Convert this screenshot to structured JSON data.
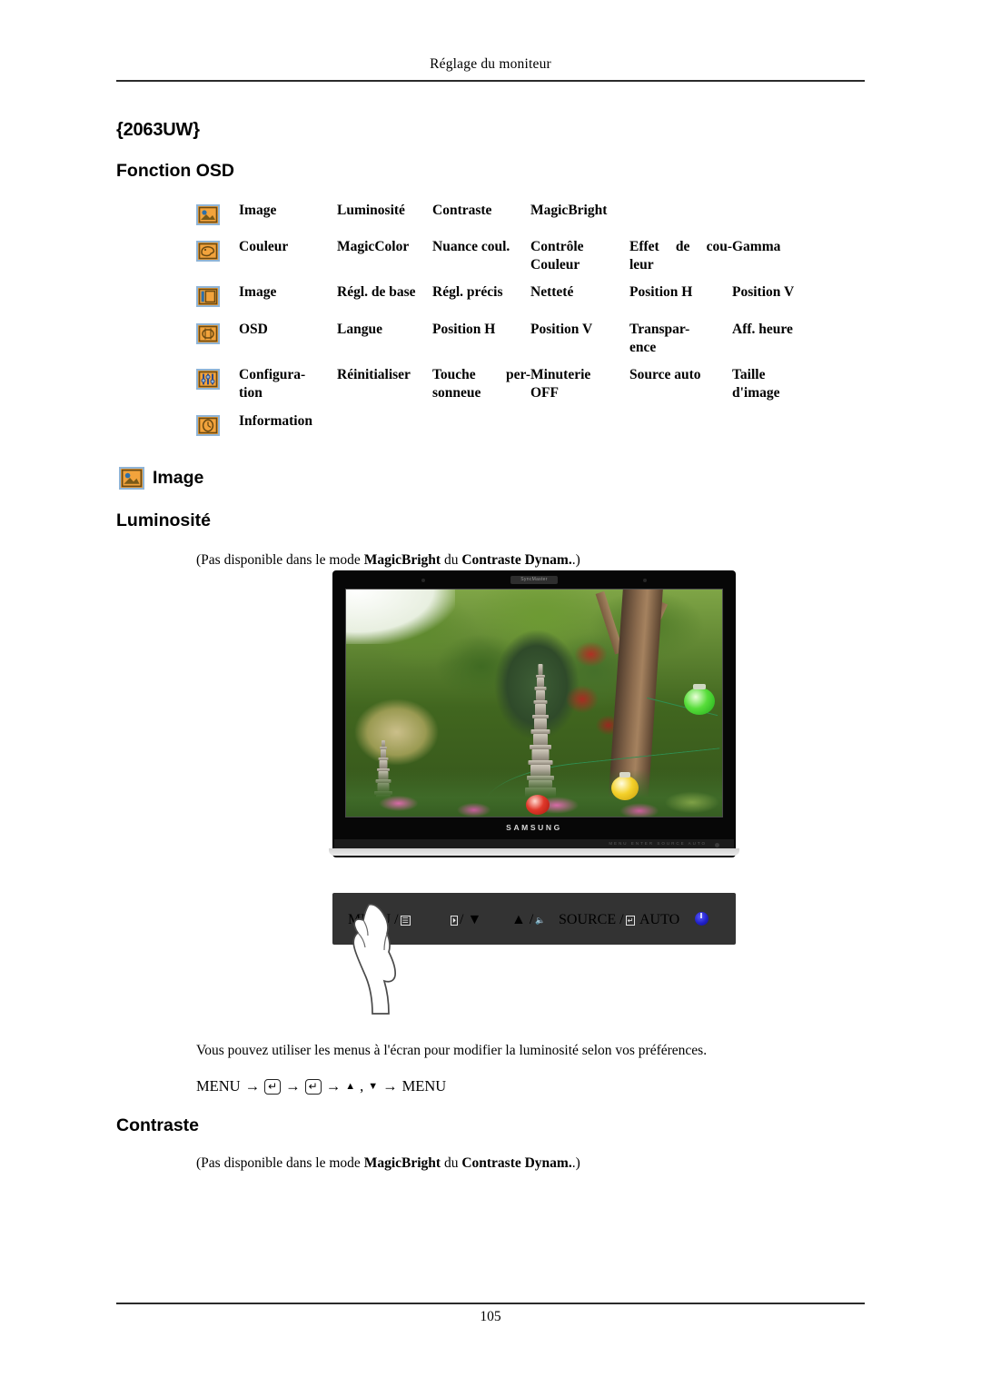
{
  "page": {
    "running_head": "Réglage du moniteur",
    "folio": "105",
    "model_heading": "{2063UW}",
    "section_heading": "Fonction OSD"
  },
  "osd_table": {
    "rows": [
      {
        "icon": "picture-icon",
        "name": "Image",
        "cells": [
          "Luminosité",
          "Contraste",
          "MagicBright",
          "",
          ""
        ]
      },
      {
        "icon": "palette-icon",
        "name": "Couleur",
        "cells": [
          "MagicColor",
          "Nuance coul.",
          "Contrôle Couleur",
          "Effet de couleur",
          "Gamma"
        ]
      },
      {
        "icon": "screen-adjust-icon",
        "name": "Image",
        "cells": [
          "Régl. de base",
          "Régl. précis",
          "Netteté",
          "Position H",
          "Position V"
        ]
      },
      {
        "icon": "osd-icon",
        "name": "OSD",
        "cells": [
          "Langue",
          "Position H",
          "Position V",
          "Transparence",
          "Aff. heure"
        ]
      },
      {
        "icon": "sliders-icon",
        "name": "Configuration",
        "cells": [
          "Réinitialiser",
          "Touche personneue",
          "Minuterie OFF",
          "Source auto",
          "Taille d'image"
        ]
      },
      {
        "icon": "clock-info-icon",
        "name": "Information",
        "cells": [
          "",
          "",
          "",
          "",
          ""
        ]
      }
    ],
    "justified_cells": {
      "effet_de_couleur_line1": "Effet de cou-",
      "effet_de_couleur_line2": "leur",
      "transparence_line1": "Transpar-",
      "transparence_line2": "ence",
      "touche_line1": "Touche per-",
      "touche_line2": "sonneue",
      "configuration_line1": "Configura-",
      "configuration_line2": "tion",
      "controle_line1": "Contrôle",
      "controle_line2": "Couleur",
      "minuterie_line1": "Minuterie",
      "minuterie_line2": "OFF",
      "taille_line1": "Taille",
      "taille_line2": "d'image"
    }
  },
  "image_section": {
    "heading": "Image",
    "icon": "picture-icon"
  },
  "luminosite": {
    "heading": "Luminosité",
    "note_prefix": "(Pas disponible dans le mode ",
    "note_bold_1": "MagicBright",
    "note_mid": " du ",
    "note_bold_2": "Contraste Dynam.",
    "note_suffix": ".)",
    "body": "Vous pouvez utiliser les menus à l'écran pour modifier la luminosité selon vos préférences.",
    "menu_path": {
      "start": "MENU",
      "arrow": "→",
      "key1": "↵",
      "key2": "↵",
      "up": "▲",
      "comma": ",",
      "down": "▼",
      "end": "MENU"
    }
  },
  "contraste": {
    "heading": "Contraste",
    "note_prefix": "(Pas disponible dans le mode ",
    "note_bold_1": "MagicBright",
    "note_mid": " du ",
    "note_bold_2": "Contraste Dynam.",
    "note_suffix": ".)"
  },
  "monitor": {
    "brand": "SAMSUNG",
    "top_mark": "SyncMaster",
    "bottom_marks": "MENU   ENTER   SOURCE   AUTO",
    "control_panel": {
      "buttons": [
        {
          "label": "MENU /",
          "icon": "menu-bars-icon"
        },
        {
          "label": "/ ▼",
          "icon": "magicbright-key-icon"
        },
        {
          "label": "▲ /",
          "icon": "volume-icon"
        },
        {
          "label": "SOURCE /",
          "icon": "enter-key-icon"
        },
        {
          "label": "AUTO",
          "icon": ""
        },
        {
          "label": "",
          "icon": "power-icon"
        }
      ]
    }
  },
  "colors": {
    "icon_fill": "#f2a33c",
    "icon_border": "#8fb4d6",
    "panel_bg": "#333333",
    "power_led": "#2020c8",
    "rule": "#2b2b2b"
  }
}
